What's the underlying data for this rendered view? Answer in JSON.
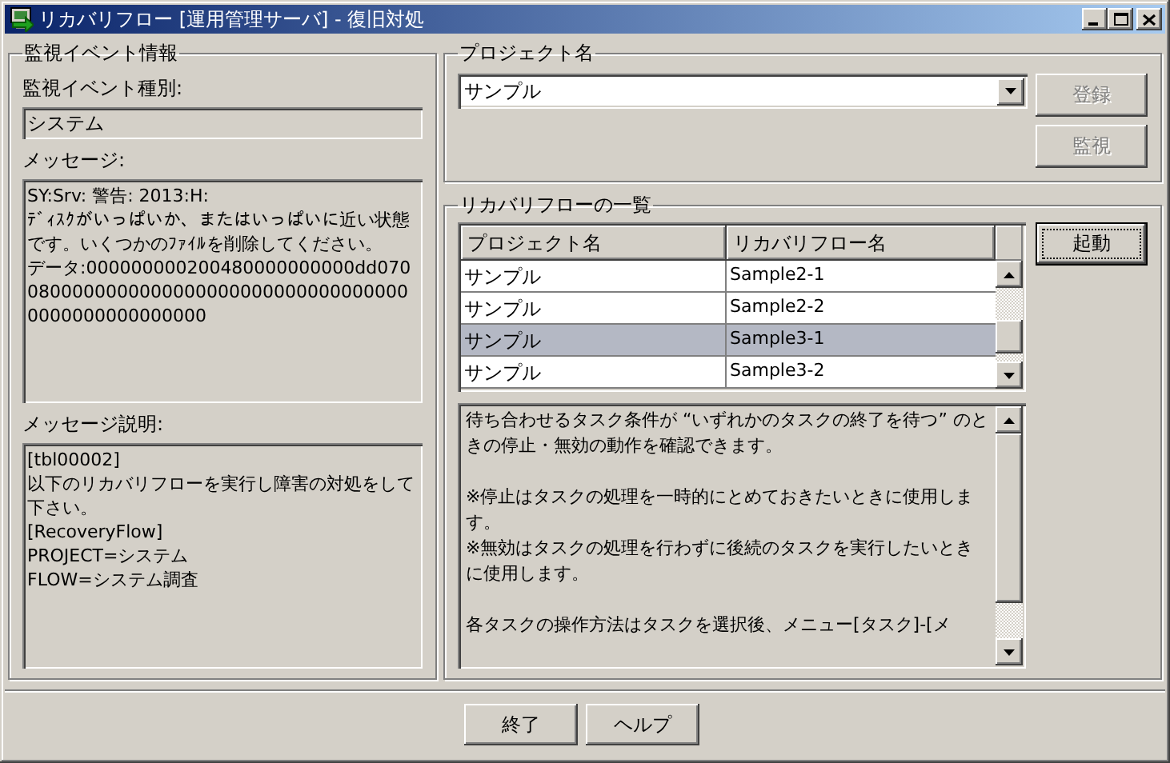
{
  "window": {
    "title": "リカバリフロー [運用管理サーバ] - 復旧対処"
  },
  "event_info": {
    "title": "監視イベント情報",
    "type_label": "監視イベント種別:",
    "type_value": "システム",
    "message_label": "メッセージ:",
    "message": [
      "SY:Srv: 警告: 2013:H:",
      "ﾃﾞｨｽｸがいっぱいか、またはいっぱいに近い状態です。いくつかのﾌｧｲﾙを削除してください。",
      "データ:000000000200480000000000dd07008000000000000000000000000000000000000000000000000"
    ],
    "description_label": "メッセージ説明:",
    "description": [
      "[tbl00002]",
      "以下のリカバリフローを実行し障害の対処をして下さい。",
      "[RecoveryFlow]",
      "PROJECT=システム",
      "FLOW=システム調査"
    ]
  },
  "project": {
    "title": "プロジェクト名",
    "value": "サンプル",
    "buttons": [
      {
        "label": "登録",
        "disabled": true
      },
      {
        "label": "監視",
        "disabled": true
      }
    ]
  },
  "flows": {
    "title": "リカバリフローの一覧",
    "columns": [
      "プロジェクト名",
      "リカバリフロー名"
    ],
    "rows": [
      {
        "project": "サンプル",
        "flow": "Sample2-1",
        "selected": false
      },
      {
        "project": "サンプル",
        "flow": "Sample2-2",
        "selected": false
      },
      {
        "project": "サンプル",
        "flow": "Sample3-1",
        "selected": true
      },
      {
        "project": "サンプル",
        "flow": "Sample3-2",
        "selected": false
      }
    ],
    "start_button": {
      "label": "起動",
      "focused": true
    },
    "note": [
      [
        "待ち合わせるタスク条件が “いずれかのタスクの終了を待つ” のときの停止・無効の動作を確認できます。"
      ],
      [
        "※停止はタスクの処理を一時的にとめておきたいときに使用します。",
        "※無効はタスクの処理を行わずに後続のタスクを実行したいときに使用します。"
      ],
      [
        "各タスクの操作方法はタスクを選択後、メニュー[タスク]-[メ"
      ]
    ]
  },
  "footer_buttons": [
    "終了",
    "ヘルプ"
  ]
}
